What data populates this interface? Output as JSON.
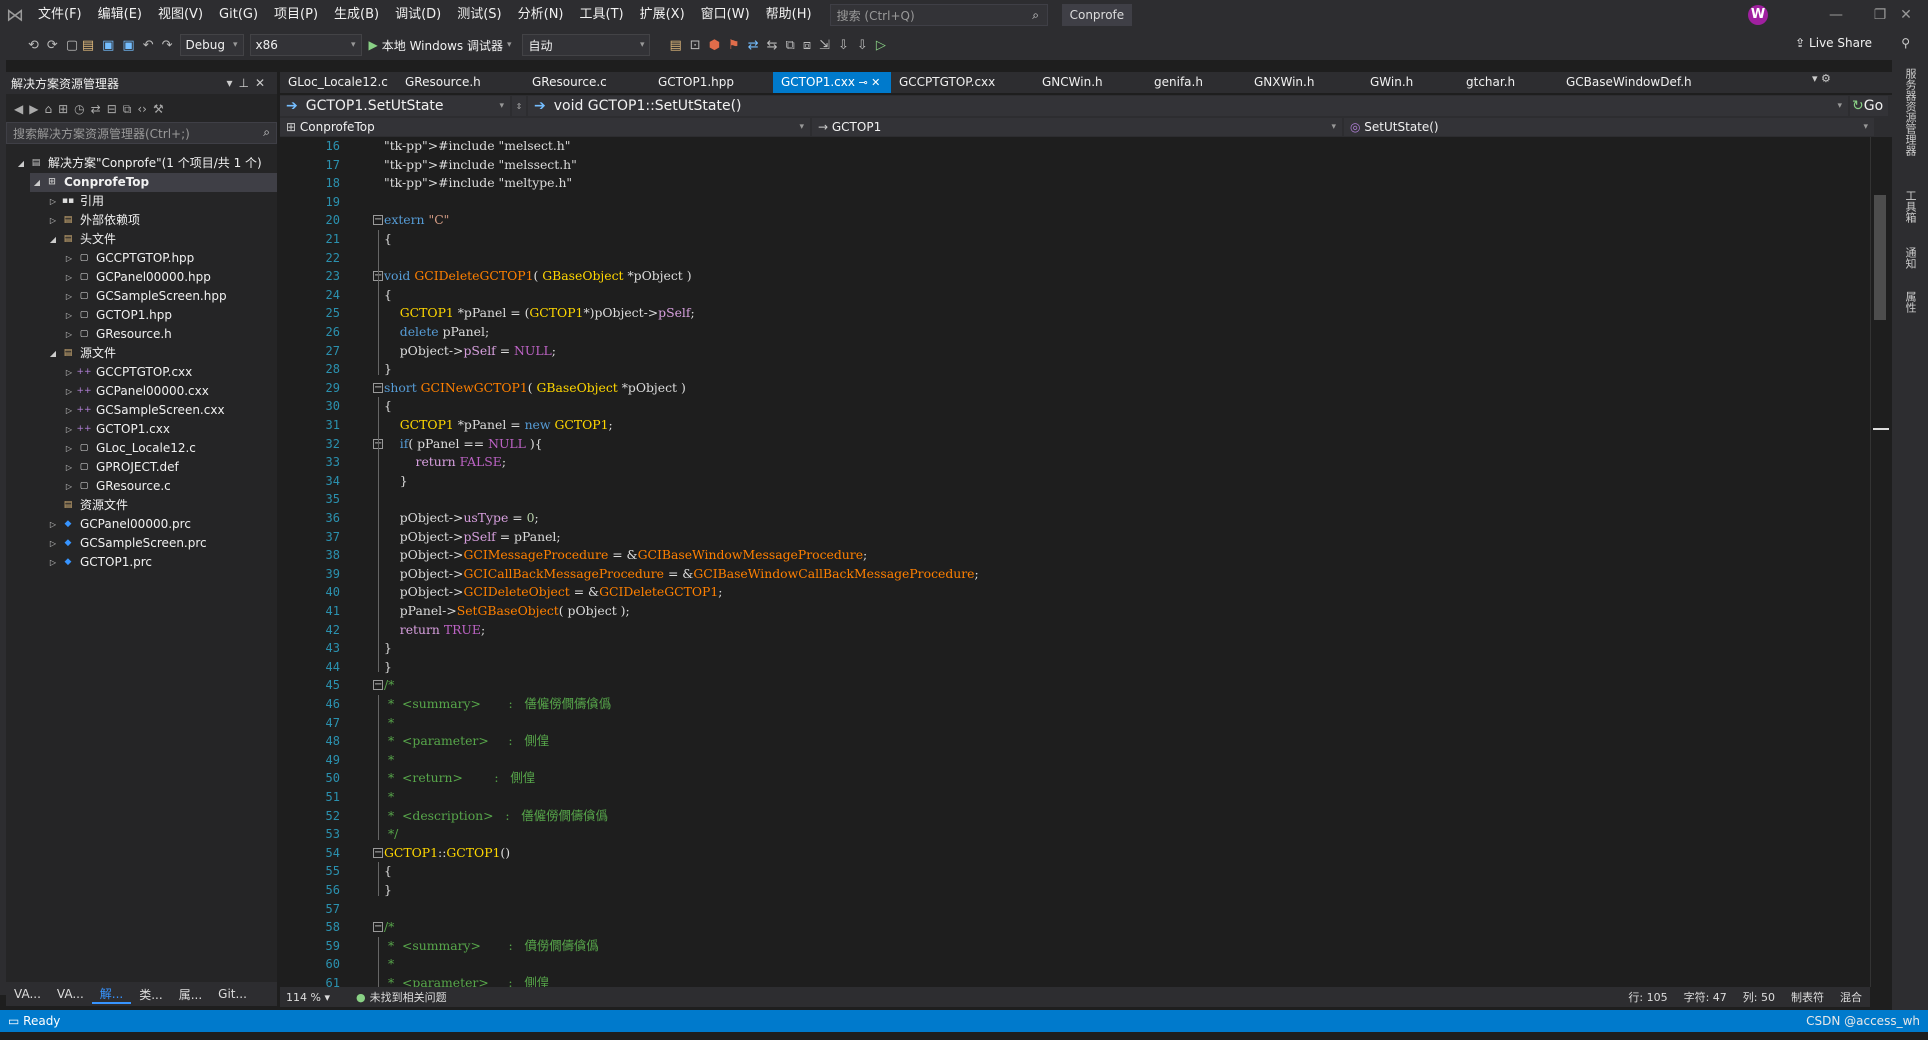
{
  "menu": [
    "文件(F)",
    "编辑(E)",
    "视图(V)",
    "Git(G)",
    "项目(P)",
    "生成(B)",
    "调试(D)",
    "测试(S)",
    "分析(N)",
    "工具(T)",
    "扩展(X)",
    "窗口(W)",
    "帮助(H)"
  ],
  "search_placeholder": "搜索 (Ctrl+Q)",
  "solution_name": "Conprofe",
  "avatar_letter": "W",
  "toolbar": {
    "config": "Debug",
    "platform": "x86",
    "debugger": "本地 Windows 调试器",
    "auto": "自动",
    "live_share": "Live Share"
  },
  "explorer": {
    "title": "解决方案资源管理器",
    "search_placeholder": "搜索解决方案资源管理器(Ctrl+;)",
    "items": [
      {
        "label": "解决方案\"Conprofe\"(1 个项目/共 1 个)",
        "indent": 0
      },
      {
        "label": "ConprofeTop",
        "indent": 1
      },
      {
        "label": "引用",
        "indent": 2
      },
      {
        "label": "外部依赖项",
        "indent": 2
      },
      {
        "label": "头文件",
        "indent": 2
      },
      {
        "label": "GCCPTGTOP.hpp",
        "indent": 3
      },
      {
        "label": "GCPanel00000.hpp",
        "indent": 3
      },
      {
        "label": "GCSampleScreen.hpp",
        "indent": 3
      },
      {
        "label": "GCTOP1.hpp",
        "indent": 3
      },
      {
        "label": "GResource.h",
        "indent": 3
      },
      {
        "label": "源文件",
        "indent": 2
      },
      {
        "label": "GCCPTGTOP.cxx",
        "indent": 3
      },
      {
        "label": "GCPanel00000.cxx",
        "indent": 3
      },
      {
        "label": "GCSampleScreen.cxx",
        "indent": 3
      },
      {
        "label": "GCTOP1.cxx",
        "indent": 3
      },
      {
        "label": "GLoc_Locale12.c",
        "indent": 3
      },
      {
        "label": "GPROJECT.def",
        "indent": 3
      },
      {
        "label": "GResource.c",
        "indent": 3
      },
      {
        "label": "资源文件",
        "indent": 2
      },
      {
        "label": "GCPanel00000.prc",
        "indent": 2
      },
      {
        "label": "GCSampleScreen.prc",
        "indent": 2
      },
      {
        "label": "GCTOP1.prc",
        "indent": 2
      }
    ],
    "bottom_tabs": [
      "VA...",
      "VA...",
      "解...",
      "类...",
      "属...",
      "Git..."
    ]
  },
  "tabs": [
    "GLoc_Locale12.c",
    "GResource.h",
    "GResource.c",
    "GCTOP1.hpp",
    "GCTOP1.cxx",
    "GCCPTGTOP.cxx",
    "GNCWin.h",
    "genifa.h",
    "GNXWin.h",
    "GWin.h",
    "gtchar.h",
    "GCBaseWindowDef.h"
  ],
  "nav": {
    "scope": "GCTOP1.SetUtState",
    "member": "void GCTOP1::SetUtState()",
    "go": "Go",
    "project": "ConprofeTop",
    "class": "GCTOP1",
    "func": "SetUtState()"
  },
  "code_lines": [
    {
      "n": "16",
      "t": "#include \"melsect.h\""
    },
    {
      "n": "17",
      "t": "#include \"melssect.h\""
    },
    {
      "n": "18",
      "t": "#include \"meltype.h\""
    },
    {
      "n": "19",
      "t": ""
    },
    {
      "n": "20",
      "t": "extern \"C\""
    },
    {
      "n": "21",
      "t": "{"
    },
    {
      "n": "22",
      "t": ""
    },
    {
      "n": "23",
      "t": "void GCIDeleteGCTOP1( GBaseObject *pObject )"
    },
    {
      "n": "24",
      "t": "{"
    },
    {
      "n": "25",
      "t": "    GCTOP1 *pPanel = (GCTOP1*)pObject->pSelf;"
    },
    {
      "n": "26",
      "t": "    delete pPanel;"
    },
    {
      "n": "27",
      "t": "    pObject->pSelf = NULL;"
    },
    {
      "n": "28",
      "t": "}"
    },
    {
      "n": "29",
      "t": "short GCINewGCTOP1( GBaseObject *pObject )"
    },
    {
      "n": "30",
      "t": "{"
    },
    {
      "n": "31",
      "t": "    GCTOP1 *pPanel = new GCTOP1;"
    },
    {
      "n": "32",
      "t": "    if( pPanel == NULL ){"
    },
    {
      "n": "33",
      "t": "        return FALSE;"
    },
    {
      "n": "34",
      "t": "    }"
    },
    {
      "n": "35",
      "t": ""
    },
    {
      "n": "36",
      "t": "    pObject->usType = 0;"
    },
    {
      "n": "37",
      "t": "    pObject->pSelf = pPanel;"
    },
    {
      "n": "38",
      "t": "    pObject->GCIMessageProcedure = &GCIBaseWindowMessageProcedure;"
    },
    {
      "n": "39",
      "t": "    pObject->GCICallBackMessageProcedure = &GCIBaseWindowCallBackMessageProcedure;"
    },
    {
      "n": "40",
      "t": "    pObject->GCIDeleteObject = &GCIDeleteGCTOP1;"
    },
    {
      "n": "41",
      "t": "    pPanel->SetGBaseObject( pObject );"
    },
    {
      "n": "42",
      "t": "    return TRUE;"
    },
    {
      "n": "43",
      "t": "}"
    },
    {
      "n": "44",
      "t": "}"
    },
    {
      "n": "45",
      "t": "/*"
    },
    {
      "n": "46",
      "t": " *  <summary>       :   僐僱僗僩儔僋僞"
    },
    {
      "n": "47",
      "t": " *"
    },
    {
      "n": "48",
      "t": " *  <parameter>     :   側偟"
    },
    {
      "n": "49",
      "t": " *"
    },
    {
      "n": "50",
      "t": " *  <return>        :   側偟"
    },
    {
      "n": "51",
      "t": " *"
    },
    {
      "n": "52",
      "t": " *  <description>   :   僐僱僗僩儔僋僞"
    },
    {
      "n": "53",
      "t": " */"
    },
    {
      "n": "54",
      "t": "GCTOP1::GCTOP1()"
    },
    {
      "n": "55",
      "t": "{"
    },
    {
      "n": "56",
      "t": "}"
    },
    {
      "n": "57",
      "t": ""
    },
    {
      "n": "58",
      "t": "/*"
    },
    {
      "n": "59",
      "t": " *  <summary>       :   僨僗僩儔僋僞"
    },
    {
      "n": "60",
      "t": " *"
    },
    {
      "n": "61",
      "t": " *  <parameter>     :   側偟"
    }
  ],
  "status_row": {
    "zoom": "114 %",
    "issues": "未找到相关问题",
    "line": "行: 105",
    "char": "字符: 47",
    "col": "列: 50",
    "tabs": "制表符",
    "eol": "混合"
  },
  "statusbar": {
    "ready": "Ready",
    "watermark": "CSDN @access_wh"
  },
  "right_panel": [
    "服务器资源管理器",
    "工具箱",
    "通知",
    "属性"
  ]
}
